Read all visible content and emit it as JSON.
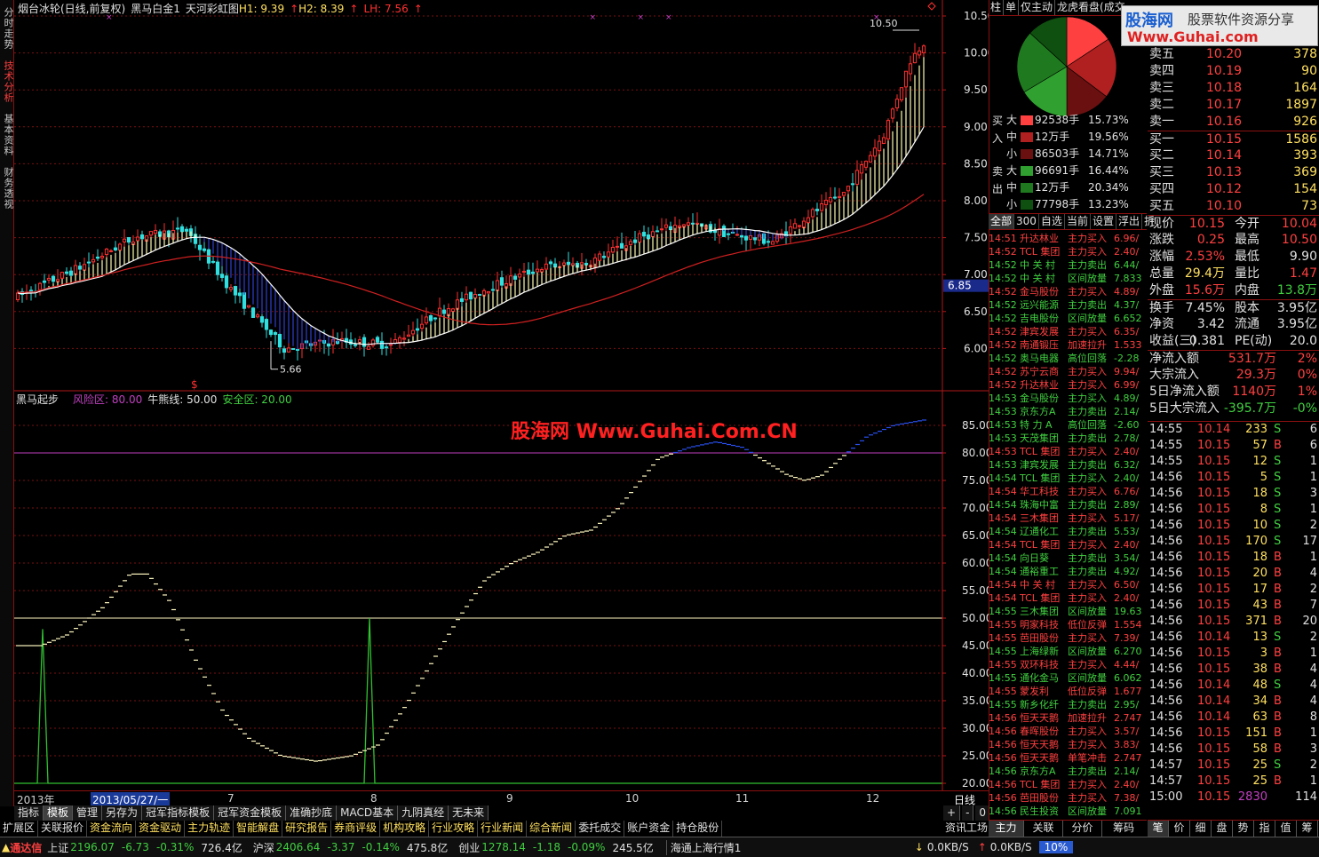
{
  "side_tabs": [
    {
      "label": "分时走势",
      "active": false
    },
    {
      "label": "技术分析",
      "active": true
    },
    {
      "label": "基本资料",
      "active": false
    },
    {
      "label": "财务透视",
      "active": false
    }
  ],
  "main_header": {
    "title": "烟台冰轮(日线,前复权)",
    "indicator": "黑马白金1",
    "sub_indicator": "天河彩虹图",
    "h1": "H1: 9.39",
    "h2": "H2: 8.39",
    "lh": "LH: 7.56"
  },
  "main_chart": {
    "price_axis": [
      "10.50",
      "10.00",
      "9.50",
      "9.00",
      "8.50",
      "8.00",
      "7.50",
      "7.00",
      "6.50",
      "6.00"
    ],
    "current_price_tag": "6.85",
    "high_marker": "10.50",
    "low_marker": "5.66",
    "buy_signal_marker": "$"
  },
  "sub_header": {
    "title": "黑马起步",
    "risk_label": "风险区: 80.00",
    "bull_label": "牛熊线: 50.00",
    "safe_label": "安全区: 20.00"
  },
  "sub_axis": [
    "85.00",
    "80.00",
    "75.00",
    "70.00",
    "65.00",
    "60.00",
    "55.00",
    "50.00",
    "45.00",
    "40.00",
    "35.00",
    "30.00",
    "25.00",
    "20.00"
  ],
  "watermark": "股海网 Www.Guhai.Com.CN",
  "date_axis": {
    "year": "2013年",
    "cursor_date": "2013/05/27/一",
    "months": [
      "7",
      "8",
      "9",
      "10",
      "11",
      "12"
    ],
    "period": "日线"
  },
  "tab_row1": [
    "指标",
    "模板",
    "管理",
    "另存为",
    "冠军指标模板",
    "冠军资金模板",
    "准确抄底",
    "MACD基本",
    "九阴真经",
    "无未来"
  ],
  "tab_row1_selected": "模板",
  "zoom_controls": [
    "+",
    "-",
    "0"
  ],
  "tab_row2": [
    "扩展区",
    "关联报价",
    "资金流向",
    "资金驱动",
    "主力轨迹",
    "智能解盘",
    "研究报告",
    "券商评级",
    "机构攻略",
    "行业攻略",
    "行业新闻",
    "综合新闻",
    "委托成交",
    "账户资金",
    "持仓股份"
  ],
  "status_bar": {
    "app": "通达信",
    "sh_name": "上证",
    "sh_value": "2196.07",
    "sh_change": "-6.73",
    "sh_pct": "-0.31%",
    "sh_amount": "726.4亿",
    "sz_name": "沪深",
    "sz_value": "2406.64",
    "sz_change": "-3.37",
    "sz_pct": "-0.14%",
    "sz_amount": "475.8亿",
    "cy_name": "创业",
    "cy_value": "1278.14",
    "cy_change": "-1.18",
    "cy_pct": "-0.09%",
    "cy_amount": "245.5亿",
    "news": "海通上海行情1",
    "down_speed": "0.0KB/S",
    "up_speed": "0.0KB/S",
    "cpu": "10%"
  },
  "right_top_tabs": [
    "柱",
    "单",
    "仅主动",
    "龙虎看盘(成交"
  ],
  "logo": {
    "brand": "股海网",
    "subtitle": "股票软件资源分享",
    "url": "Www.Guhai.com"
  },
  "pie_colors": [
    "#ff4040",
    "#b02020",
    "#6a1010",
    "#30a030",
    "#1f7a1f",
    "#0f4f0f"
  ],
  "flow": {
    "buy_side_label": "买入",
    "sell_side_label": "卖出",
    "buy": [
      {
        "size": "大",
        "volume": "92538手",
        "pct": "15.73%",
        "color": "#ff4040"
      },
      {
        "size": "中",
        "volume": "12万手",
        "pct": "19.56%",
        "color": "#b02020"
      },
      {
        "size": "小",
        "volume": "86503手",
        "pct": "14.71%",
        "color": "#6a1010"
      }
    ],
    "sell": [
      {
        "size": "大",
        "volume": "96691手",
        "pct": "16.44%",
        "color": "#30a030"
      },
      {
        "size": "中",
        "volume": "12万手",
        "pct": "20.34%",
        "color": "#1f7a1f"
      },
      {
        "size": "小",
        "volume": "77798手",
        "pct": "13.23%",
        "color": "#0f4f0f"
      }
    ]
  },
  "flow_tabs": [
    "全部",
    "300",
    "自选",
    "当前",
    "设置",
    "浮出",
    "折"
  ],
  "flow_tabs_selected": "全部",
  "trade_list": [
    [
      "14:51",
      "升达林业",
      "主力买入",
      "6.96/",
      "r"
    ],
    [
      "14:52",
      "TCL 集团",
      "主力买入",
      "2.40/",
      "r"
    ],
    [
      "14:52",
      "中 关 村",
      "主力卖出",
      "6.44/",
      "g"
    ],
    [
      "14:52",
      "中 关 村",
      "区间放量",
      "7.833",
      "g"
    ],
    [
      "14:52",
      "金马股份",
      "主力买入",
      "4.89/",
      "r"
    ],
    [
      "14:52",
      "远兴能源",
      "主力卖出",
      "4.37/",
      "g"
    ],
    [
      "14:52",
      "吉电股份",
      "区间放量",
      "6.652",
      "g"
    ],
    [
      "14:52",
      "津宾发展",
      "主力买入",
      "6.35/",
      "r"
    ],
    [
      "14:52",
      "南通锻压",
      "加速拉升",
      "1.533",
      "r"
    ],
    [
      "14:52",
      "奥马电器",
      "高位回落",
      "-2.28",
      "g"
    ],
    [
      "14:52",
      "苏宁云商",
      "主力买入",
      "9.94/",
      "r"
    ],
    [
      "14:52",
      "升达林业",
      "主力买入",
      "6.99/",
      "r"
    ],
    [
      "14:53",
      "金马股份",
      "主力买入",
      "4.89/",
      "g"
    ],
    [
      "14:53",
      "京东方A",
      "主力卖出",
      "2.14/",
      "g"
    ],
    [
      "14:53",
      "特 力 A",
      "高位回落",
      "-2.60",
      "g"
    ],
    [
      "14:53",
      "天茂集团",
      "主力卖出",
      "2.78/",
      "g"
    ],
    [
      "14:53",
      "TCL 集团",
      "主力买入",
      "2.40/",
      "r"
    ],
    [
      "14:53",
      "津宾发展",
      "主力卖出",
      "6.32/",
      "g"
    ],
    [
      "14:54",
      "TCL 集团",
      "主力买入",
      "2.40/",
      "g"
    ],
    [
      "14:54",
      "华工科技",
      "主力买入",
      "6.76/",
      "r"
    ],
    [
      "14:54",
      "珠海中富",
      "主力卖出",
      "2.89/",
      "g"
    ],
    [
      "14:54",
      "三木集团",
      "主力买入",
      "5.17/",
      "r"
    ],
    [
      "14:54",
      "辽通化工",
      "主力卖出",
      "5.53/",
      "g"
    ],
    [
      "14:54",
      "TCL 集团",
      "主力买入",
      "2.40/",
      "r"
    ],
    [
      "14:54",
      "向日葵",
      "主力卖出",
      "3.54/",
      "g"
    ],
    [
      "14:54",
      "通裕重工",
      "主力卖出",
      "4.92/",
      "g"
    ],
    [
      "14:54",
      "中 关 村",
      "主力买入",
      "6.50/",
      "r"
    ],
    [
      "14:54",
      "TCL 集团",
      "主力买入",
      "2.40/",
      "r"
    ],
    [
      "14:55",
      "三木集团",
      "区间放量",
      "19.63",
      "g"
    ],
    [
      "14:55",
      "明家科技",
      "低位反弹",
      "1.554",
      "r"
    ],
    [
      "14:55",
      "芭田股份",
      "主力买入",
      "7.39/",
      "r"
    ],
    [
      "14:55",
      "上海绿新",
      "区间放量",
      "6.270",
      "g"
    ],
    [
      "14:55",
      "双环科技",
      "主力买入",
      "4.44/",
      "r"
    ],
    [
      "14:55",
      "通化金马",
      "区间放量",
      "6.062",
      "g"
    ],
    [
      "14:55",
      "蒙发利",
      "低位反弹",
      "1.677",
      "r"
    ],
    [
      "14:55",
      "新乡化纤",
      "主力卖出",
      "2.95/",
      "g"
    ],
    [
      "14:56",
      "恒天天鹅",
      "加速拉升",
      "2.747",
      "r"
    ],
    [
      "14:56",
      "春晖股份",
      "主力买入",
      "3.57/",
      "r"
    ],
    [
      "14:56",
      "恒天天鹅",
      "主力买入",
      "3.83/",
      "r"
    ],
    [
      "14:56",
      "恒天天鹅",
      "单笔冲击",
      "2.747",
      "r"
    ],
    [
      "14:56",
      "京东方A",
      "主力卖出",
      "2.14/",
      "g"
    ],
    [
      "14:56",
      "TCL 集团",
      "主力买入",
      "2.40/",
      "r"
    ],
    [
      "14:56",
      "芭田股份",
      "主力买入",
      "7.38/",
      "r"
    ],
    [
      "14:56",
      "民生投资",
      "区间放量",
      "7.091",
      "g"
    ]
  ],
  "right_bottom_tabs": [
    "主力",
    "关联",
    "分价",
    "筹码"
  ],
  "order_book": {
    "sell": [
      {
        "label": "卖五",
        "price": "10.20",
        "vol": "378"
      },
      {
        "label": "卖四",
        "price": "10.19",
        "vol": "90"
      },
      {
        "label": "卖三",
        "price": "10.18",
        "vol": "164"
      },
      {
        "label": "卖二",
        "price": "10.17",
        "vol": "1897"
      },
      {
        "label": "卖一",
        "price": "10.16",
        "vol": "926"
      }
    ],
    "buy": [
      {
        "label": "买一",
        "price": "10.15",
        "vol": "1586"
      },
      {
        "label": "买二",
        "price": "10.14",
        "vol": "393"
      },
      {
        "label": "买三",
        "price": "10.13",
        "vol": "369"
      },
      {
        "label": "买四",
        "price": "10.12",
        "vol": "154"
      },
      {
        "label": "买五",
        "price": "10.10",
        "vol": "73"
      }
    ]
  },
  "quote_stats": [
    [
      "现价",
      "10.15",
      "r",
      "今开",
      "10.04",
      "r"
    ],
    [
      "涨跌",
      "0.25",
      "r",
      "最高",
      "10.50",
      "r"
    ],
    [
      "涨幅",
      "2.53%",
      "r",
      "最低",
      "9.90",
      "w"
    ],
    [
      "总量",
      "29.4万",
      "y",
      "量比",
      "1.47",
      "r"
    ],
    [
      "外盘",
      "15.6万",
      "r",
      "内盘",
      "13.8万",
      "g"
    ]
  ],
  "quote_stats2": [
    [
      "换手",
      "7.45%",
      "w",
      "股本",
      "3.95亿",
      "w"
    ],
    [
      "净资",
      "3.42",
      "w",
      "流通",
      "3.95亿",
      "w"
    ],
    [
      "收益(三)",
      "0.381",
      "w",
      "PE(动)",
      "20.0",
      "w"
    ]
  ],
  "capital_flow": [
    [
      "净流入额",
      "531.7万",
      "2%",
      "r"
    ],
    [
      "大宗流入",
      "29.3万",
      "0%",
      "r"
    ],
    [
      "5日净流入额",
      "1140万",
      "1%",
      "r"
    ],
    [
      "5日大宗流入",
      "-395.7万",
      "-0%",
      "g"
    ]
  ],
  "ticks": [
    [
      "14:55",
      "10.14",
      "233",
      "S",
      "6"
    ],
    [
      "14:55",
      "10.15",
      "57",
      "B",
      "6"
    ],
    [
      "14:55",
      "10.15",
      "12",
      "S",
      "1"
    ],
    [
      "14:56",
      "10.15",
      "5",
      "S",
      "1"
    ],
    [
      "14:56",
      "10.15",
      "18",
      "S",
      "3"
    ],
    [
      "14:56",
      "10.15",
      "8",
      "S",
      "1"
    ],
    [
      "14:56",
      "10.15",
      "10",
      "S",
      "2"
    ],
    [
      "14:56",
      "10.15",
      "170",
      "S",
      "17"
    ],
    [
      "14:56",
      "10.15",
      "18",
      "B",
      "1"
    ],
    [
      "14:56",
      "10.15",
      "20",
      "B",
      "4"
    ],
    [
      "14:56",
      "10.15",
      "17",
      "B",
      "2"
    ],
    [
      "14:56",
      "10.15",
      "43",
      "B",
      "7"
    ],
    [
      "14:56",
      "10.15",
      "371",
      "B",
      "20"
    ],
    [
      "14:56",
      "10.14",
      "13",
      "S",
      "2"
    ],
    [
      "14:56",
      "10.15",
      "3",
      "B",
      "1"
    ],
    [
      "14:56",
      "10.15",
      "38",
      "B",
      "4"
    ],
    [
      "14:56",
      "10.14",
      "48",
      "S",
      "4"
    ],
    [
      "14:56",
      "10.14",
      "34",
      "B",
      "4"
    ],
    [
      "14:56",
      "10.14",
      "63",
      "B",
      "8"
    ],
    [
      "14:56",
      "10.15",
      "151",
      "B",
      "1"
    ],
    [
      "14:56",
      "10.15",
      "58",
      "B",
      "3"
    ],
    [
      "14:57",
      "10.15",
      "25",
      "S",
      "2"
    ],
    [
      "14:57",
      "10.15",
      "25",
      "B",
      "1"
    ],
    [
      "15:00",
      "10.15",
      "2830",
      "",
      "114"
    ]
  ],
  "quote_bottom_tabs": [
    "笔",
    "价",
    "细",
    "盘",
    "势",
    "指",
    "值",
    "筹"
  ]
}
